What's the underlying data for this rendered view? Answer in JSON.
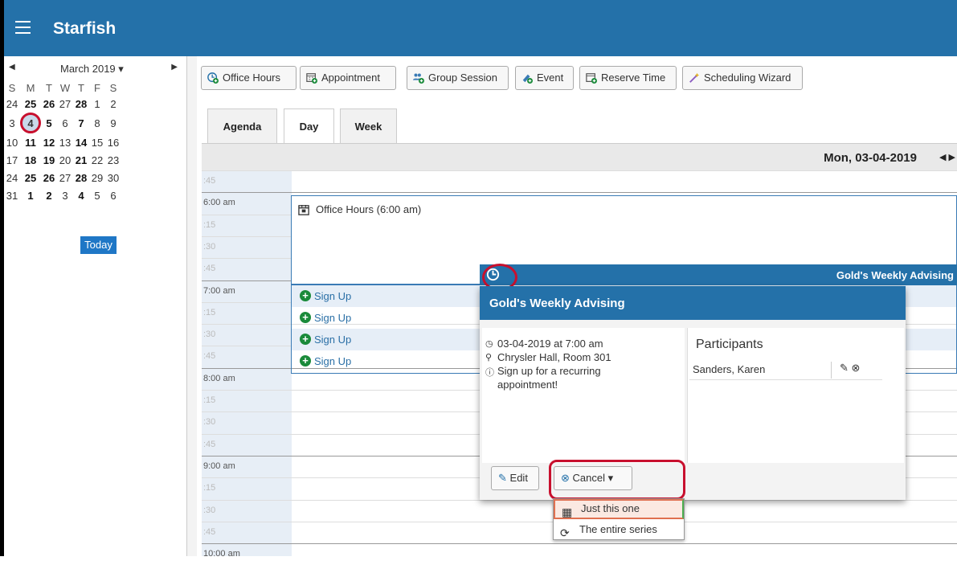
{
  "app": {
    "brand": "Starfish"
  },
  "mini_calendar": {
    "month_label": "March 2019 ▾",
    "weekdays": [
      "S",
      "M",
      "T",
      "W",
      "T",
      "F",
      "S"
    ],
    "weeks": [
      [
        "24",
        "25",
        "26",
        "27",
        "28",
        "1",
        "2"
      ],
      [
        "3",
        "4",
        "5",
        "6",
        "7",
        "8",
        "9"
      ],
      [
        "10",
        "11",
        "12",
        "13",
        "14",
        "15",
        "16"
      ],
      [
        "17",
        "18",
        "19",
        "20",
        "21",
        "22",
        "23"
      ],
      [
        "24",
        "25",
        "26",
        "27",
        "28",
        "29",
        "30"
      ],
      [
        "31",
        "1",
        "2",
        "3",
        "4",
        "5",
        "6"
      ]
    ],
    "today_label": "Today"
  },
  "toolbar": {
    "office_hours": "Office Hours",
    "appointment": "Appointment",
    "group_session": "Group Session",
    "event": "Event",
    "reserve_time": "Reserve Time",
    "scheduling_wizard": "Scheduling Wizard"
  },
  "tabs": {
    "agenda": "Agenda",
    "day": "Day",
    "week": "Week"
  },
  "day_view": {
    "date": "Mon, 03-04-2019",
    "time_labels": [
      ":45",
      "6:00 am",
      ":15",
      ":30",
      ":45",
      "7:00 am",
      ":15",
      ":30",
      ":45",
      "8:00 am",
      ":15",
      ":30",
      ":45",
      "9:00 am",
      ":15",
      ":30",
      ":45",
      "10:00 am"
    ],
    "office_hours_title": "Office Hours (6:00 am)",
    "sign_up_label": "Sign Up",
    "event_bar_title": "Gold's Weekly Advising"
  },
  "popup": {
    "title": "Gold's Weekly Advising",
    "datetime": "03-04-2019 at 7:00 am",
    "location": "Chrysler Hall, Room 301",
    "note_line1": "Sign up for a recurring",
    "note_line2": "appointment!",
    "participants_title": "Participants",
    "participant": "Sanders, Karen",
    "edit_label": "Edit",
    "cancel_label": "Cancel"
  },
  "cancel_menu": {
    "just_this_one": "Just this one",
    "entire_series": "The entire series"
  },
  "colors": {
    "header": "#2471a9",
    "highlight_ring": "#c8102e",
    "today": "#1f77c6",
    "signup_icon": "#1a8a3a"
  }
}
